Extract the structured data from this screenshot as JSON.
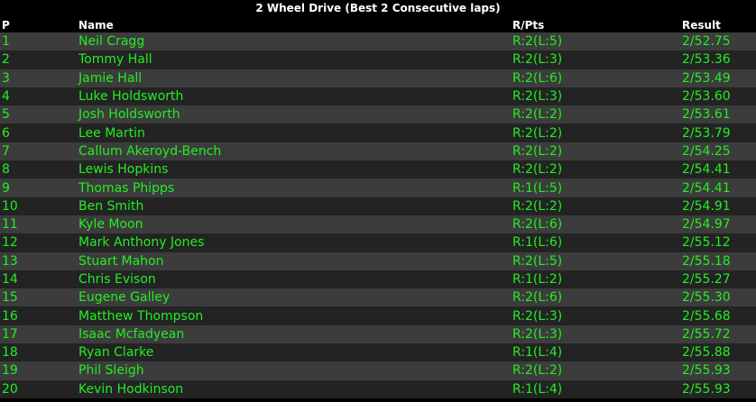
{
  "title": "2 Wheel Drive (Best 2 Consecutive laps)",
  "headers": {
    "p": "P",
    "name": "Name",
    "rpts": "R/Pts",
    "result": "Result"
  },
  "colors": {
    "background": "#000000",
    "row_light": "#3c3c3c",
    "row_dark": "#232323",
    "row_text": "#22ee22",
    "header_text": "#ffffff"
  },
  "rows": [
    {
      "p": "1",
      "name": "Neil Cragg",
      "rpts": "R:2(L:5)",
      "result": "2/52.75"
    },
    {
      "p": "2",
      "name": "Tommy Hall",
      "rpts": "R:2(L:3)",
      "result": "2/53.36"
    },
    {
      "p": "3",
      "name": "Jamie Hall",
      "rpts": "R:2(L:6)",
      "result": "2/53.49"
    },
    {
      "p": "4",
      "name": "Luke Holdsworth",
      "rpts": "R:2(L:3)",
      "result": "2/53.60"
    },
    {
      "p": "5",
      "name": "Josh Holdsworth",
      "rpts": "R:2(L:2)",
      "result": "2/53.61"
    },
    {
      "p": "6",
      "name": "Lee Martin",
      "rpts": "R:2(L:2)",
      "result": "2/53.79"
    },
    {
      "p": "7",
      "name": "Callum Akeroyd-Bench",
      "rpts": "R:2(L:2)",
      "result": "2/54.25"
    },
    {
      "p": "8",
      "name": "Lewis Hopkins",
      "rpts": "R:2(L:2)",
      "result": "2/54.41"
    },
    {
      "p": "9",
      "name": "Thomas Phipps",
      "rpts": "R:1(L:5)",
      "result": "2/54.41"
    },
    {
      "p": "10",
      "name": "Ben Smith",
      "rpts": "R:2(L:2)",
      "result": "2/54.91"
    },
    {
      "p": "11",
      "name": "Kyle Moon",
      "rpts": "R:2(L:6)",
      "result": "2/54.97"
    },
    {
      "p": "12",
      "name": "Mark Anthony Jones",
      "rpts": "R:1(L:6)",
      "result": "2/55.12"
    },
    {
      "p": "13",
      "name": "Stuart Mahon",
      "rpts": "R:2(L:5)",
      "result": "2/55.18"
    },
    {
      "p": "14",
      "name": "Chris Evison",
      "rpts": "R:1(L:2)",
      "result": "2/55.27"
    },
    {
      "p": "15",
      "name": "Eugene Galley",
      "rpts": "R:2(L:6)",
      "result": "2/55.30"
    },
    {
      "p": "16",
      "name": "Matthew Thompson",
      "rpts": "R:2(L:3)",
      "result": "2/55.68"
    },
    {
      "p": "17",
      "name": "Isaac Mcfadyean",
      "rpts": "R:2(L:3)",
      "result": "2/55.72"
    },
    {
      "p": "18",
      "name": "Ryan Clarke",
      "rpts": "R:1(L:4)",
      "result": "2/55.88"
    },
    {
      "p": "19",
      "name": "Phil Sleigh",
      "rpts": "R:2(L:2)",
      "result": "2/55.93"
    },
    {
      "p": "20",
      "name": "Kevin Hodkinson",
      "rpts": "R:1(L:4)",
      "result": "2/55.93"
    }
  ]
}
